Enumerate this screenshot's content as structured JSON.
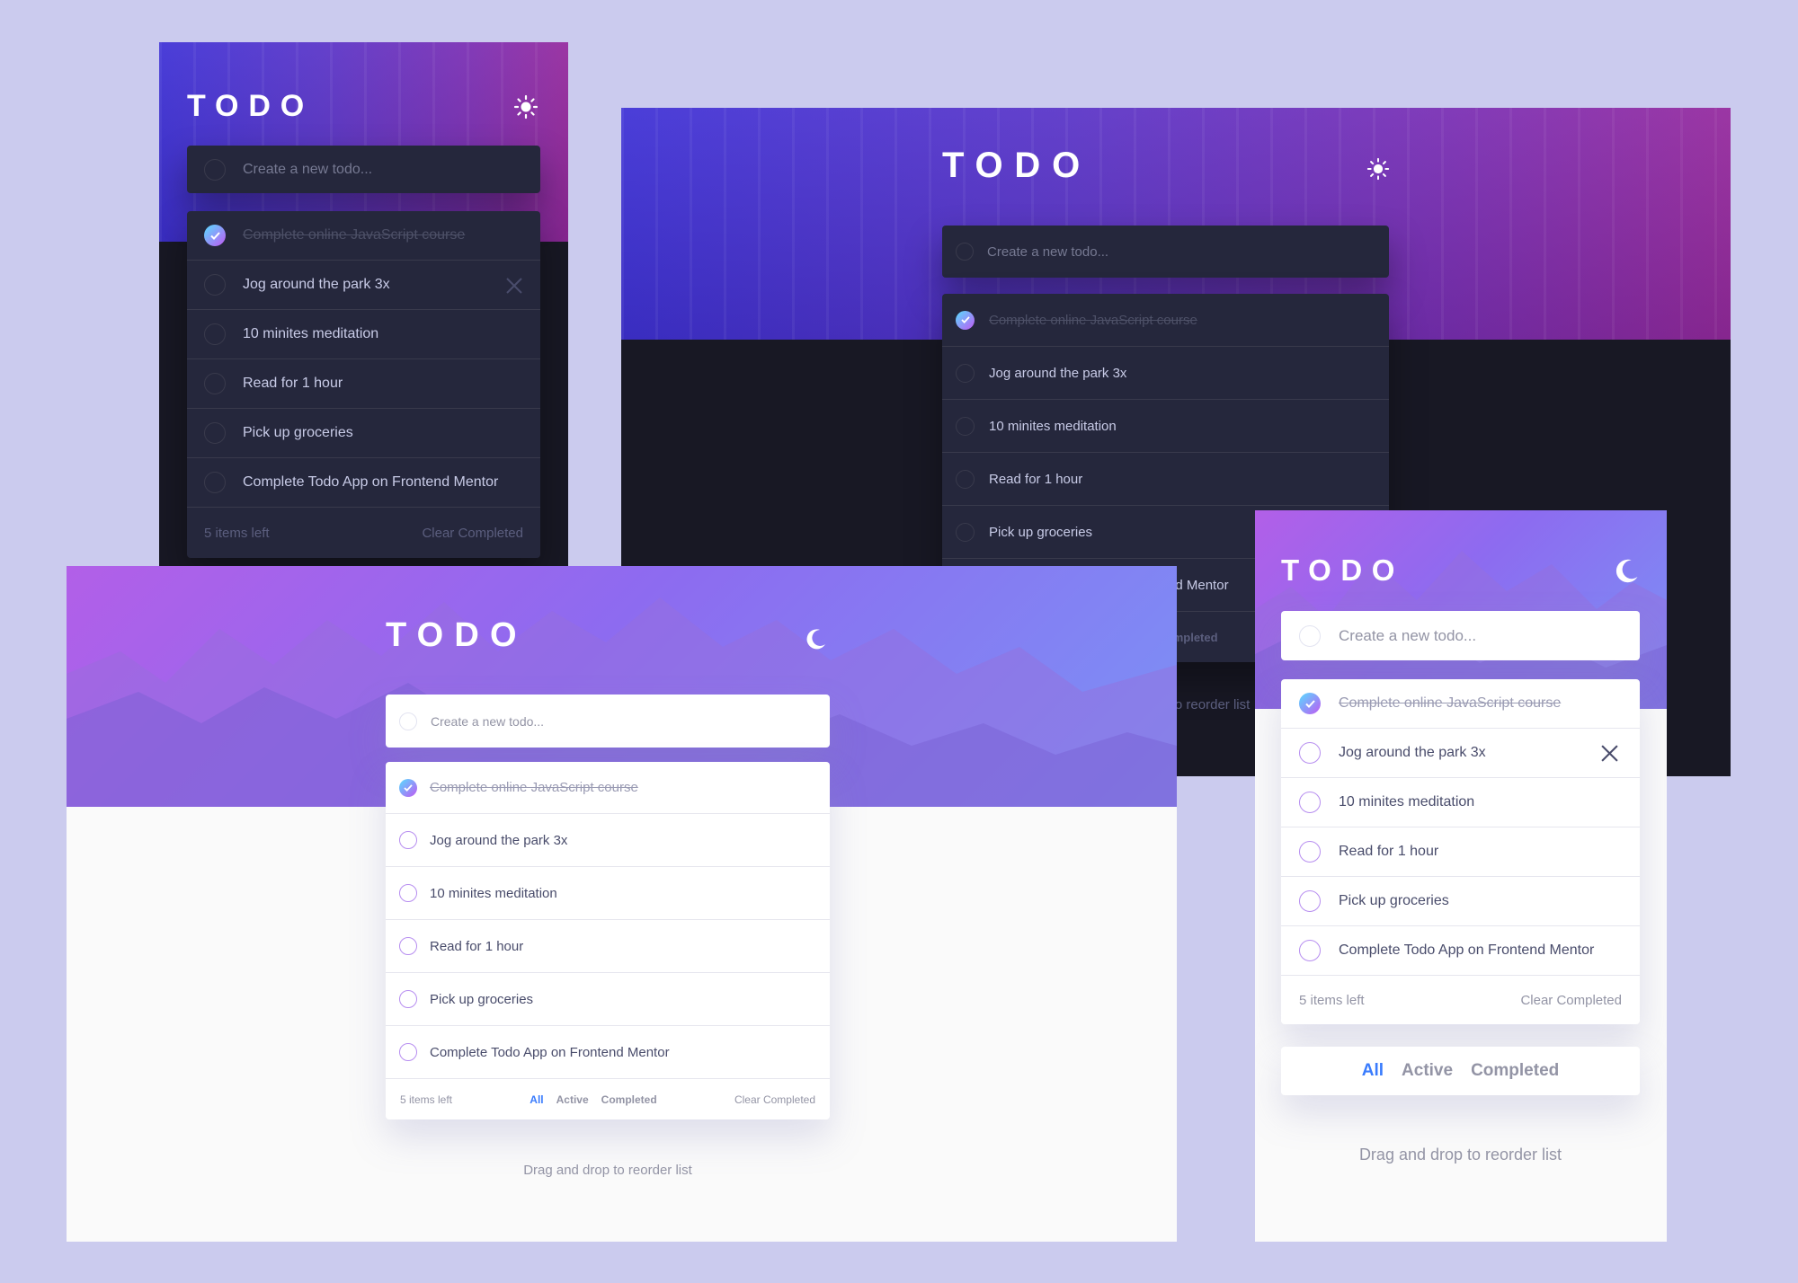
{
  "app": {
    "title": "TODO",
    "input_placeholder": "Create a new todo...",
    "todos": [
      {
        "text": "Complete online JavaScript course",
        "completed": true
      },
      {
        "text": "Jog around the park 3x",
        "completed": false
      },
      {
        "text": "10 minites meditation",
        "completed": false
      },
      {
        "text": "Read for 1 hour",
        "completed": false
      },
      {
        "text": "Pick up groceries",
        "completed": false
      },
      {
        "text": "Complete Todo App on Frontend Mentor",
        "completed": false
      }
    ],
    "items_left": "5 items left",
    "filters": {
      "all": "All",
      "active": "Active",
      "completed": "Completed"
    },
    "clear_completed": "Clear Completed",
    "drag_hint": "Drag and drop to reorder list"
  },
  "icons": {
    "dark_theme_toggle": "sun-icon",
    "light_theme_toggle": "moon-icon",
    "check": "check-icon",
    "delete": "cross-icon"
  },
  "colors": {
    "page_background": "#cbcbee",
    "dark_background": "#181824",
    "dark_card": "#25273c",
    "light_background": "#fafafa",
    "light_card": "#ffffff",
    "active_filter": "#3a7cfd",
    "check_gradient_start": "#57ddff",
    "check_gradient_end": "#c058f3"
  }
}
